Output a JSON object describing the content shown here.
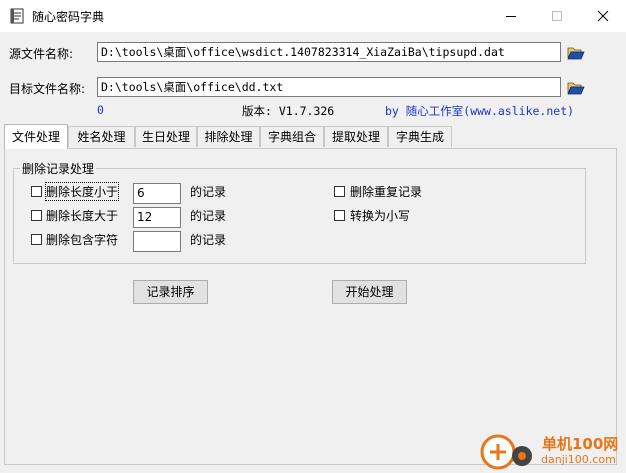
{
  "window": {
    "title": "随心密码字典"
  },
  "source": {
    "label": "源文件名称:",
    "path": "D:\\tools\\桌面\\office\\wsdict.1407823314_XiaZaiBa\\tipsupd.dat"
  },
  "target": {
    "label": "目标文件名称:",
    "path": "D:\\tools\\桌面\\office\\dd.txt"
  },
  "info": {
    "count": "0",
    "version": "版本: V1.7.326",
    "by": "by 随心工作室(www.aslike.net)"
  },
  "tabs": [
    "文件处理",
    "姓名处理",
    "生日处理",
    "排除处理",
    "字典组合",
    "提取处理",
    "字典生成"
  ],
  "group": {
    "title": "删除记录处理",
    "shorter": {
      "label": "删除长度小于",
      "value": "6",
      "suffix": "的记录"
    },
    "longer": {
      "label": "删除长度大于",
      "value": "12",
      "suffix": "的记录"
    },
    "contains": {
      "label": "删除包含字符",
      "value": "",
      "suffix": "的记录"
    },
    "dedupe": {
      "label": "删除重复记录"
    },
    "lower": {
      "label": "转换为小写"
    }
  },
  "buttons": {
    "sort": "记录排序",
    "start": "开始处理"
  },
  "watermark": {
    "name": "单机100网",
    "url": "danji100.com"
  },
  "colors": {
    "info_blue": "#1d33c8",
    "watermark_orange": "#e8751a"
  }
}
